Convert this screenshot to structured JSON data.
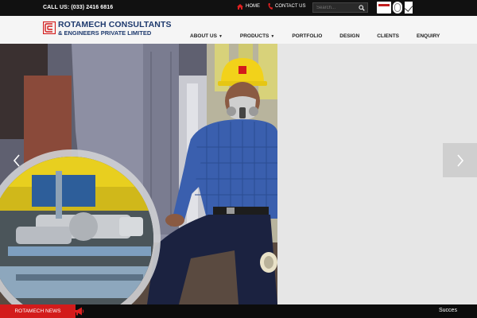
{
  "topbar": {
    "phone": "CALL US: (033) 2416 6816",
    "links": [
      {
        "label": "HOME",
        "icon": "home-icon"
      },
      {
        "label": "CONTACT US",
        "icon": "phone-icon"
      }
    ],
    "search": {
      "placeholder": "Search..."
    }
  },
  "brand": {
    "line1": "ROTAMECH CONSULTANTS",
    "line2": "& ENGINEERS PRIVATE LIMITED",
    "color": "#1e3a6e",
    "accent": "#d31b1b"
  },
  "nav": {
    "items": [
      {
        "label": "ABOUT US",
        "dropdown": true
      },
      {
        "label": "PRODUCTS",
        "dropdown": true
      },
      {
        "label": "PORTFOLIO",
        "dropdown": false
      },
      {
        "label": "DESIGN",
        "dropdown": false
      },
      {
        "label": "CLIENTS",
        "dropdown": false
      },
      {
        "label": "ENQUIRY",
        "dropdown": false
      }
    ]
  },
  "slider": {
    "prev_icon": "chevron-left-icon",
    "next_icon": "chevron-right-icon"
  },
  "footer": {
    "news_label": "ROTAMECH NEWS",
    "news_icon": "megaphone-icon",
    "ticker_text": "Succes"
  }
}
